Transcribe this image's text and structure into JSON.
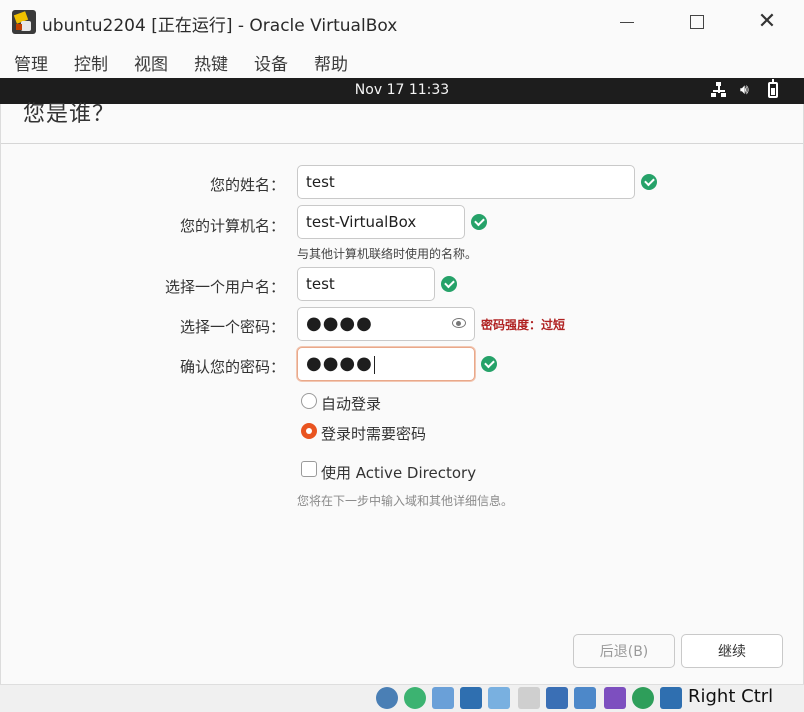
{
  "window": {
    "title": "ubuntu2204 [正在运行] - Oracle VirtualBox"
  },
  "menu": [
    "管理",
    "控制",
    "视图",
    "热键",
    "设备",
    "帮助"
  ],
  "guest_topbar": {
    "clock": "Nov 17  11:33"
  },
  "page": {
    "heading": "您是谁？"
  },
  "form": {
    "name_label": "您的姓名：",
    "name_value": "test",
    "computer_label": "您的计算机名：",
    "computer_value": "test-VirtualBox",
    "computer_hint": "与其他计算机联络时使用的名称。",
    "username_label": "选择一个用户名：",
    "username_value": "test",
    "password_label": "选择一个密码：",
    "password_value": "●●●●",
    "password_strength": "密码强度：过短",
    "confirm_label": "确认您的密码：",
    "confirm_value": "●●●●",
    "auto_login_label": "自动登录",
    "require_password_label": "登录时需要密码",
    "selected_login_option": "require_password",
    "active_directory_label": "使用 Active Directory",
    "active_directory_checked": false,
    "active_directory_hint": "您将在下一步中输入域和其他详细信息。"
  },
  "buttons": {
    "back": "后退(B)",
    "continue": "继续"
  },
  "statusbar": {
    "host_key": "Right Ctrl",
    "icons": [
      "optical-drive-icon",
      "audio-icon",
      "network-icon",
      "usb-icon",
      "shared-folder-icon",
      "display-icon",
      "screen-capture-icon",
      "vm-icon",
      "mouse-integration-icon",
      "download-icon"
    ]
  },
  "colors": {
    "accent": "#e95420",
    "ok": "#26a269",
    "warning_text": "#b02222",
    "guest_topbar": "#1d1d1d"
  }
}
